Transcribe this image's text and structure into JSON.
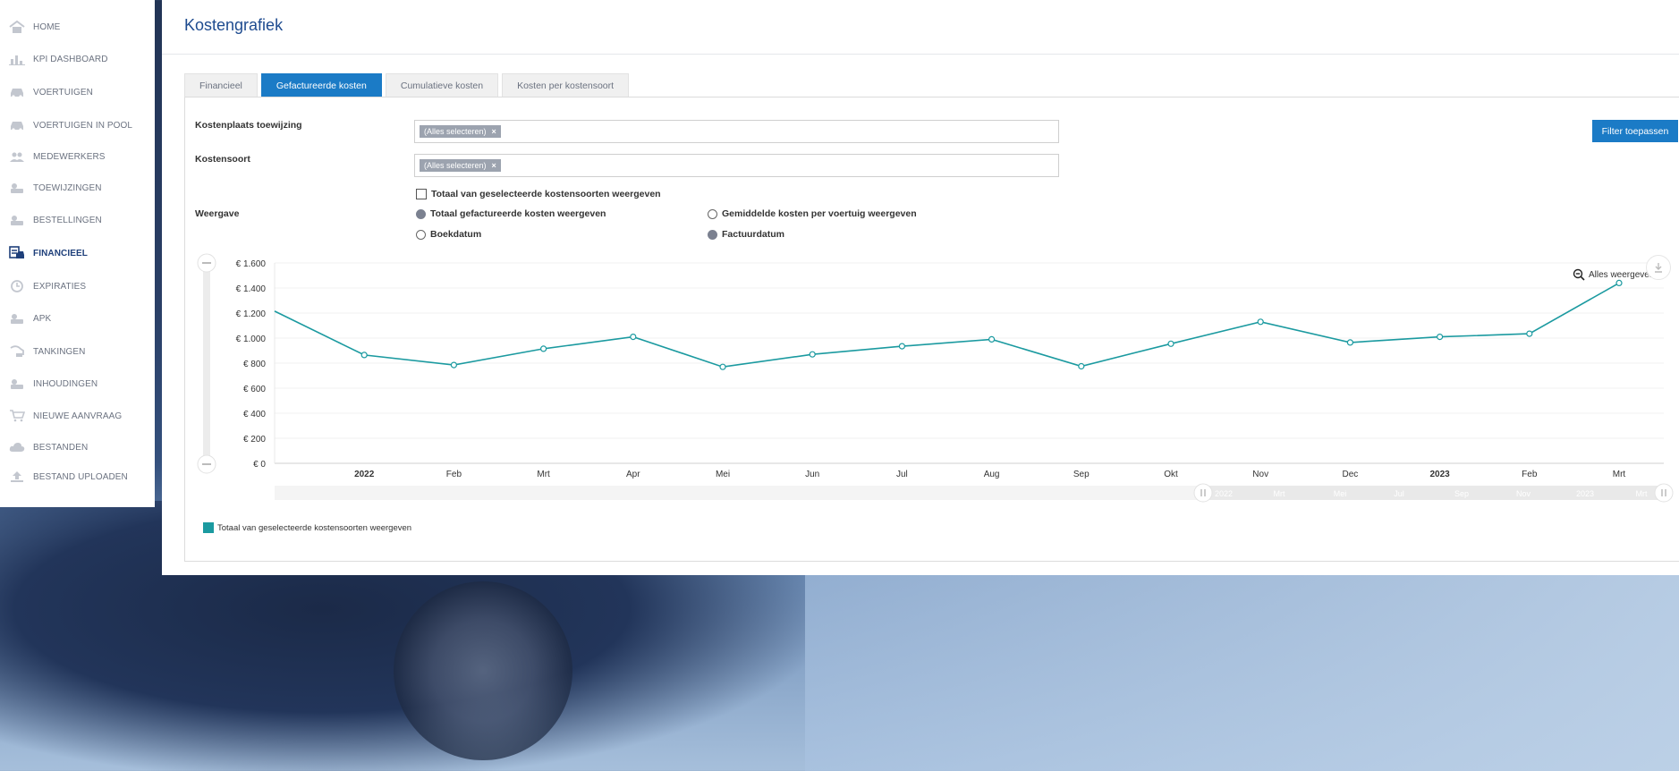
{
  "sidebar": {
    "items": [
      {
        "label": "HOME",
        "icon": "home-icon"
      },
      {
        "label": "KPI DASHBOARD",
        "icon": "bar-chart-icon"
      },
      {
        "label": "VOERTUIGEN",
        "icon": "car-icon"
      },
      {
        "label": "VOERTUIGEN IN POOL",
        "icon": "car-pool-icon"
      },
      {
        "label": "MEDEWERKERS",
        "icon": "users-icon"
      },
      {
        "label": "TOEWIJZINGEN",
        "icon": "assign-icon"
      },
      {
        "label": "BESTELLINGEN",
        "icon": "order-icon"
      },
      {
        "label": "FINANCIEEL",
        "icon": "finance-icon"
      },
      {
        "label": "EXPIRATIES",
        "icon": "clock-icon"
      },
      {
        "label": "APK",
        "icon": "apk-icon"
      },
      {
        "label": "TANKINGEN",
        "icon": "fuel-icon"
      },
      {
        "label": "INHOUDINGEN",
        "icon": "deduction-icon"
      },
      {
        "label": "NIEUWE AANVRAAG",
        "icon": "cart-icon"
      },
      {
        "label": "BESTANDEN",
        "icon": "cloud-icon"
      },
      {
        "label": "BESTAND UPLOADEN",
        "icon": "upload-icon"
      }
    ],
    "active_index": 7
  },
  "page": {
    "title": "Kostengrafiek"
  },
  "tabs": [
    {
      "label": "Financieel"
    },
    {
      "label": "Gefactureerde kosten"
    },
    {
      "label": "Cumulatieve kosten"
    },
    {
      "label": "Kosten per kostensoort"
    }
  ],
  "filters": {
    "cost_center_label": "Kostenplaats toewijzing",
    "cost_center_chip": "(Alles selecteren)",
    "cost_type_label": "Kostensoort",
    "cost_type_chip": "(Alles selecteren)",
    "chip_remove": "×",
    "apply_button": "Filter toepassen",
    "total_checkbox": "Totaal van geselecteerde kostensoorten weergeven",
    "display_label": "Weergave",
    "radio_total": "Totaal gefactureerde kosten weergeven",
    "radio_avg": "Gemiddelde kosten per voertuig weergeven",
    "radio_bookdate": "Boekdatum",
    "radio_invoicedate": "Factuurdatum"
  },
  "chart_controls": {
    "zoom_reset": "Alles weergeven",
    "navigator_labels": [
      "2022",
      "Mrt",
      "Mei",
      "Jul",
      "Sep",
      "Nov",
      "2023",
      "Mrt"
    ]
  },
  "colors": {
    "accent": "#1b7bc6",
    "series": "#1b9aa0",
    "title": "#1e4b8f"
  },
  "chart_data": {
    "type": "line",
    "x": [
      "",
      "2022",
      "Feb",
      "Mrt",
      "Apr",
      "Mei",
      "Jun",
      "Jul",
      "Aug",
      "Sep",
      "Okt",
      "Nov",
      "Dec",
      "2023",
      "Feb",
      "Mrt"
    ],
    "x_bold": [
      "2022",
      "2023"
    ],
    "series": [
      {
        "name": "Totaal van geselecteerde kostensoorten weergeven",
        "values": [
          1215,
          865,
          785,
          915,
          1010,
          770,
          870,
          935,
          990,
          775,
          955,
          1130,
          965,
          1010,
          1035,
          1440
        ]
      }
    ],
    "ylim": [
      0,
      1600
    ],
    "yticks": [
      0,
      200,
      400,
      600,
      800,
      1000,
      1200,
      1400,
      1600
    ],
    "ytick_labels": [
      "€ 0",
      "€ 200",
      "€ 400",
      "€ 600",
      "€ 800",
      "€ 1.000",
      "€ 1.200",
      "€ 1.400",
      "€ 1.600"
    ],
    "grid": true,
    "legend": "bottom-left"
  }
}
